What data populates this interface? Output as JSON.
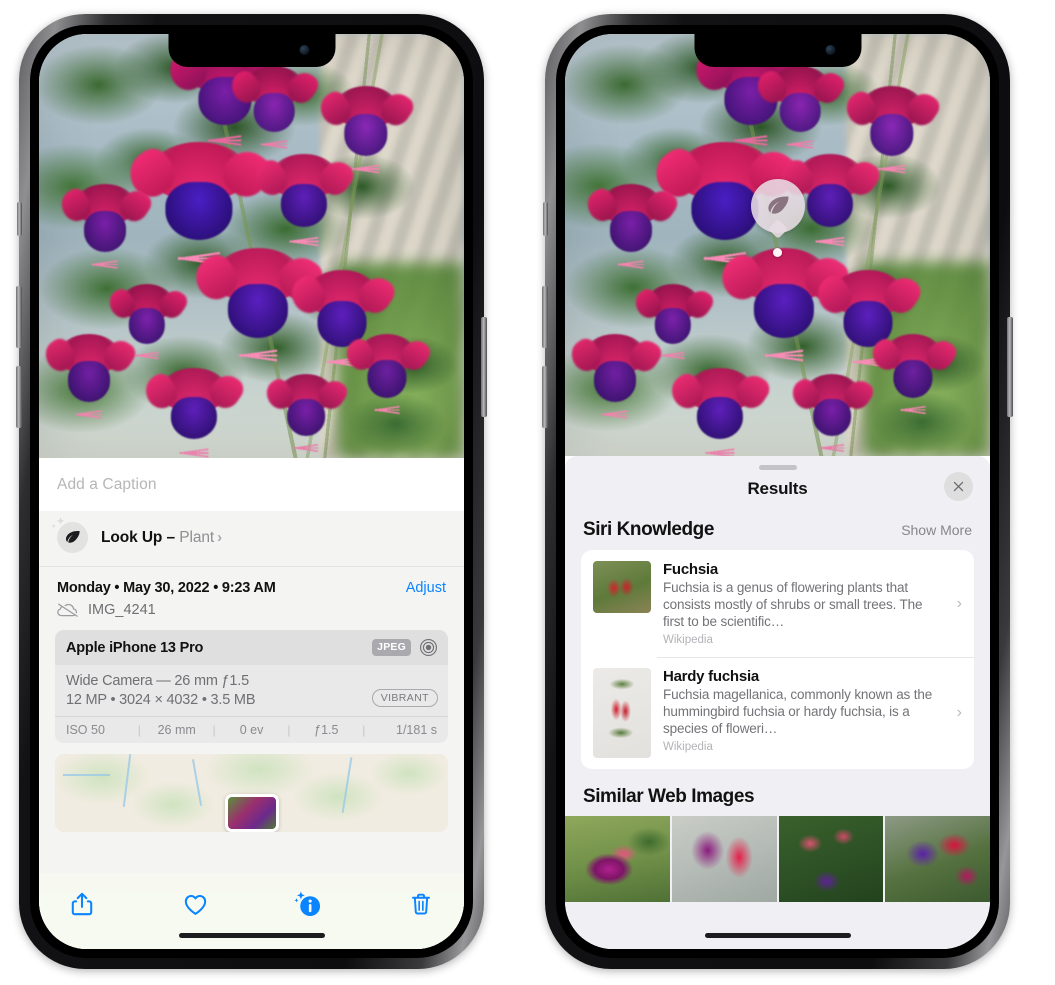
{
  "left_phone": {
    "name": "iphone-photos-info-view",
    "photo": {
      "alt": "fuchsia-flowers-hanging-basket"
    },
    "caption_placeholder": "Add a Caption",
    "lookup": {
      "icon": "leaf-icon",
      "sparkle_icon": "sparkles-icon",
      "label": "Look Up – ",
      "subject": "Plant",
      "chevron": "›"
    },
    "datetime": "Monday • May 30, 2022 • 9:23 AM",
    "adjust_label": "Adjust",
    "cloud_icon": "cloud-slash-icon",
    "filename": "IMG_4241",
    "camera": {
      "model": "Apple iPhone 13 Pro",
      "format_badge": "JPEG",
      "aperture_icon": "aperture-icon",
      "lens_line": "Wide Camera — 26 mm ƒ1.5",
      "specs_line": "12 MP • 3024 × 4032 • 3.5 MB",
      "style_badge": "VIBRANT",
      "exif": [
        "ISO 50",
        "26 mm",
        "0 ev",
        "ƒ1.5",
        "1/181 s"
      ]
    },
    "map": {
      "name": "location-map-thumbnail"
    },
    "toolbar": [
      {
        "name": "share-button",
        "icon": "share-icon"
      },
      {
        "name": "favorite-button",
        "icon": "heart-icon"
      },
      {
        "name": "info-button",
        "icon": "info-sparkle-icon"
      },
      {
        "name": "delete-button",
        "icon": "trash-icon"
      }
    ],
    "accent_color": "#0a84ff"
  },
  "right_phone": {
    "name": "iphone-visual-lookup-results",
    "badge": {
      "icon": "leaf-icon",
      "label": "visual-look-up-badge"
    },
    "sheet": {
      "grabber": "drag-handle",
      "title": "Results",
      "close_icon": "close-icon"
    },
    "siri_knowledge": {
      "title": "Siri Knowledge",
      "show_more": "Show More",
      "items": [
        {
          "title": "Fuchsia",
          "description": "Fuchsia is a genus of flowering plants that consists mostly of shrubs or small trees. The first to be scientific…",
          "source": "Wikipedia",
          "thumb": "fuchsia-red-flowers-thumb",
          "chevron": "›"
        },
        {
          "title": "Hardy fuchsia",
          "description": "Fuchsia magellanica, commonly known as the hummingbird fuchsia or hardy fuchsia, is a species of floweri…",
          "source": "Wikipedia",
          "thumb": "hardy-fuchsia-branch-thumb",
          "chevron": "›"
        }
      ]
    },
    "similar_web_images": {
      "title": "Similar Web Images",
      "items": [
        {
          "name": "web-image-1",
          "alt": "magenta-fuchsia-with-green-leaves"
        },
        {
          "name": "web-image-2",
          "alt": "red-and-purple-fuchsia-closeup"
        },
        {
          "name": "web-image-3",
          "alt": "fuchsia-buds-on-bush"
        },
        {
          "name": "web-image-4",
          "alt": "purple-and-red-double-fuchsia"
        }
      ]
    }
  }
}
